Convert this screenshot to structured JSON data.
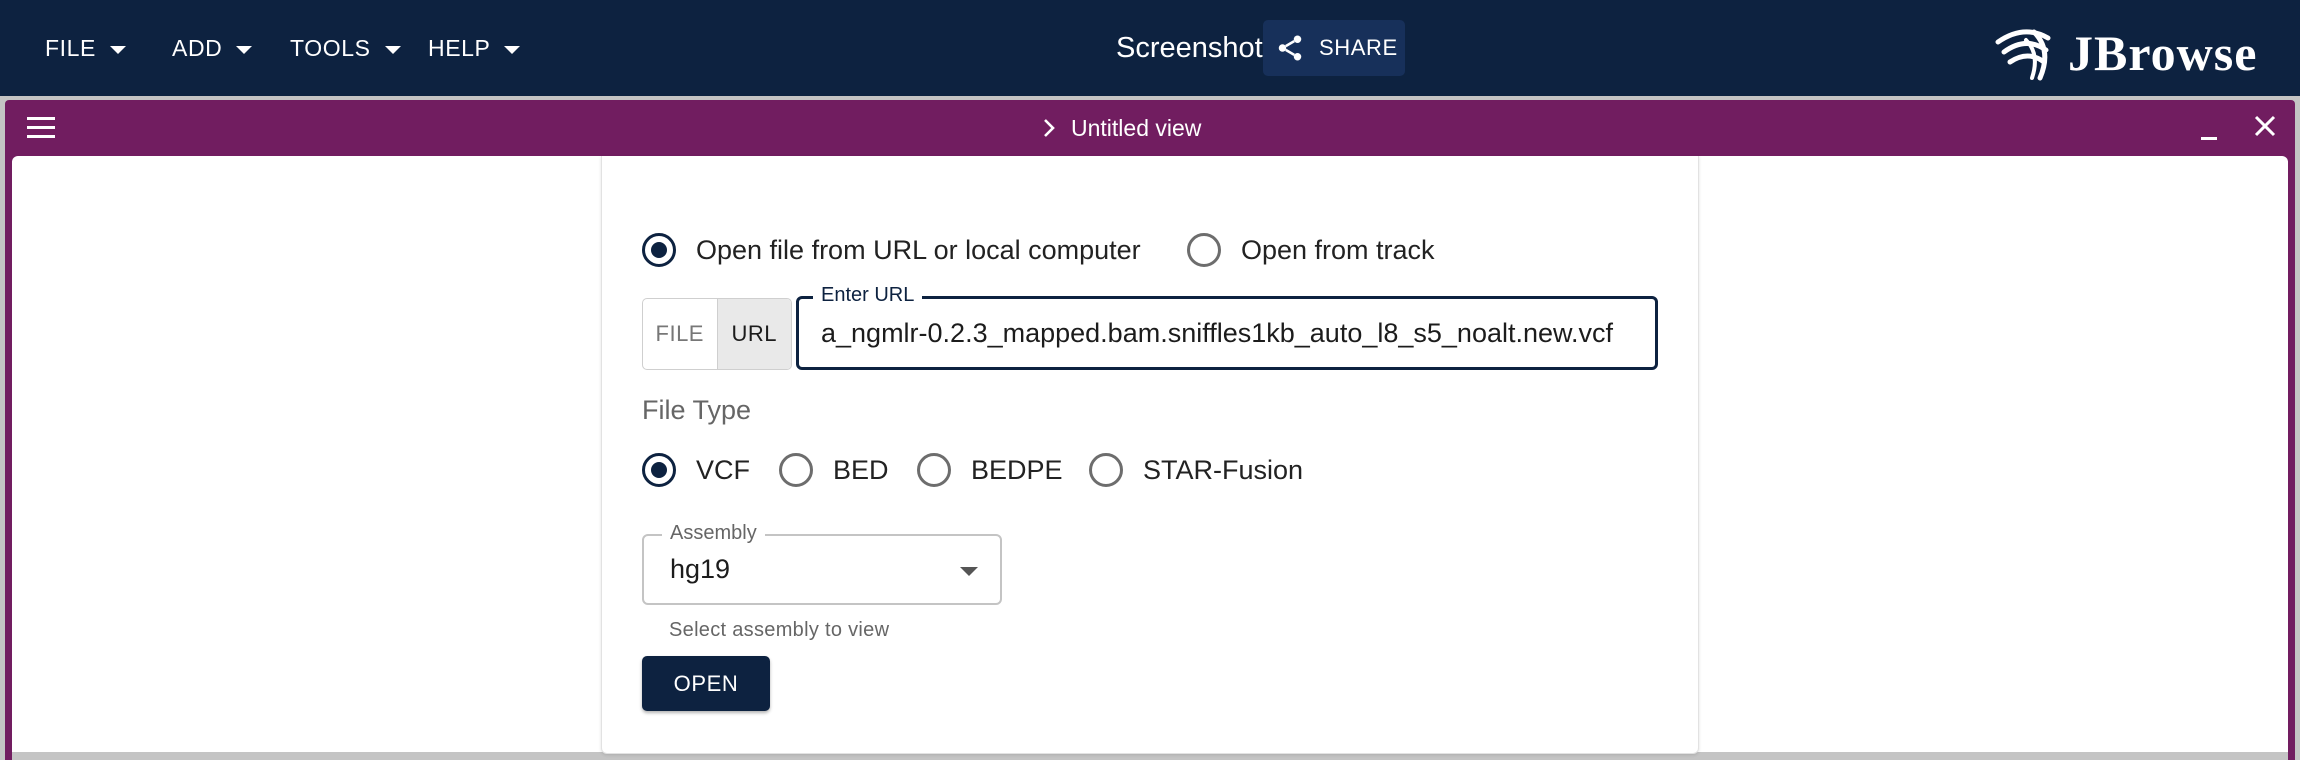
{
  "appbar": {
    "menus": [
      {
        "label": "FILE"
      },
      {
        "label": "ADD"
      },
      {
        "label": "TOOLS"
      },
      {
        "label": "HELP"
      }
    ],
    "session_title": "Screenshot",
    "share_label": "SHARE",
    "logo_text": "JBrowse",
    "color": "#0d2240"
  },
  "view": {
    "title": "Untitled view",
    "color": "#711d60"
  },
  "form": {
    "source_options": [
      {
        "label": "Open file from URL or local computer",
        "selected": true
      },
      {
        "label": "Open from track",
        "selected": false
      }
    ],
    "location_toggle": {
      "file_label": "FILE",
      "url_label": "URL",
      "selected": "URL"
    },
    "url_field": {
      "label": "Enter URL",
      "value": "a_ngmlr-0.2.3_mapped.bam.sniffles1kb_auto_l8_s5_noalt.new.vcf"
    },
    "file_type": {
      "label": "File Type",
      "options": [
        {
          "label": "VCF",
          "selected": true
        },
        {
          "label": "BED",
          "selected": false
        },
        {
          "label": "BEDPE",
          "selected": false
        },
        {
          "label": "STAR-Fusion",
          "selected": false
        }
      ]
    },
    "assembly": {
      "label": "Assembly",
      "value": "hg19",
      "helper": "Select assembly to view"
    },
    "open_label": "OPEN"
  }
}
